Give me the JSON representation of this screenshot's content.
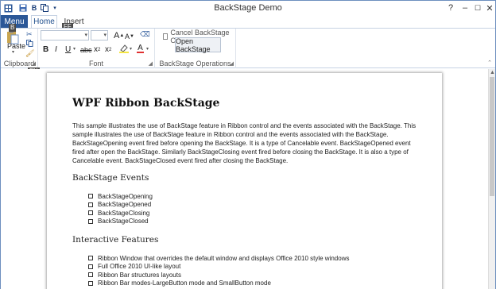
{
  "window": {
    "title": "BackStage Demo"
  },
  "qat": {
    "icons": [
      "app-icon",
      "save-icon",
      "bold-icon",
      "copy-icon",
      "dropdown-icon"
    ]
  },
  "titlebar_buttons": {
    "help": "?",
    "minimize": "–",
    "maximize": "☐",
    "close": "✕"
  },
  "tabs": {
    "menu": "Menu",
    "home": "Home",
    "insert": "Insert"
  },
  "keytips": {
    "ff": "FF",
    "b": "B",
    "fn": "FN"
  },
  "ribbon": {
    "clipboard": {
      "paste_label": "Paste",
      "group_label": "Clipboard"
    },
    "font": {
      "group_label": "Font",
      "grow": "A",
      "shrink": "A",
      "bold": "B",
      "italic": "I",
      "underline": "U",
      "strike": "abc",
      "subscript": "x",
      "superscript": "x",
      "color_a": "A"
    },
    "backstage_ops": {
      "cancel_label": "Cancel BackStage Opening",
      "open_label": "Open BackStage",
      "group_label": "BackStage Operations"
    }
  },
  "document": {
    "title": "WPF Ribbon BackStage",
    "intro": "This sample illustrates the use of BackStage feature in Ribbon control and the events associated with the BackStage. This sample illustrates the use of BackStage feature in Ribbon control and the events associated with the BackStage. BackStageOpening event fired before opening the BackStage. It is a type of Cancelable event. BackStageOpened event fired after open the BackStage. Similarly BackStageClosing event fired before closing the BackStage. It is also a type of Cancelable event. BackStageClosed event fired after closing the BackStage.",
    "section1": {
      "heading": "BackStage Events",
      "items": [
        "BackStageOpening",
        "BackStageOpened",
        "BackStageClosing",
        "BackStageClosed"
      ]
    },
    "section2": {
      "heading": "Interactive Features",
      "items": [
        "Ribbon Window that overrides the default window and displays Office 2010 style windows",
        "Full Office 2010 UI-like layout",
        "Ribbon Bar structures layouts",
        "Ribbon Bar modes-LargeButton mode and SmallButton mode"
      ]
    }
  }
}
